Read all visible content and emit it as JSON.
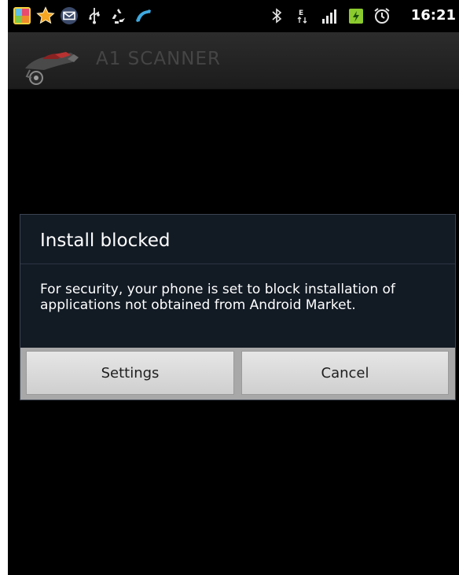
{
  "status_bar": {
    "time": "16:21",
    "left_icons": [
      "photo-gallery-icon",
      "star-icon",
      "message-icon",
      "usb-icon",
      "recycle-icon",
      "phone-call-icon"
    ],
    "right_icons": [
      "bluetooth-icon",
      "edge-network-icon",
      "signal-icon",
      "battery-icon",
      "alarm-icon"
    ]
  },
  "app_bar": {
    "title": "A1 SCANNER"
  },
  "dialog": {
    "title": "Install blocked",
    "message": "For security, your phone is set to block installation of applications not obtained from Android Market.",
    "buttons": {
      "settings": "Settings",
      "cancel": "Cancel"
    }
  },
  "colors": {
    "background": "#000000",
    "dialog_background": "#121a24",
    "button_face": "#dcdcdc",
    "title_text": "#454545"
  }
}
